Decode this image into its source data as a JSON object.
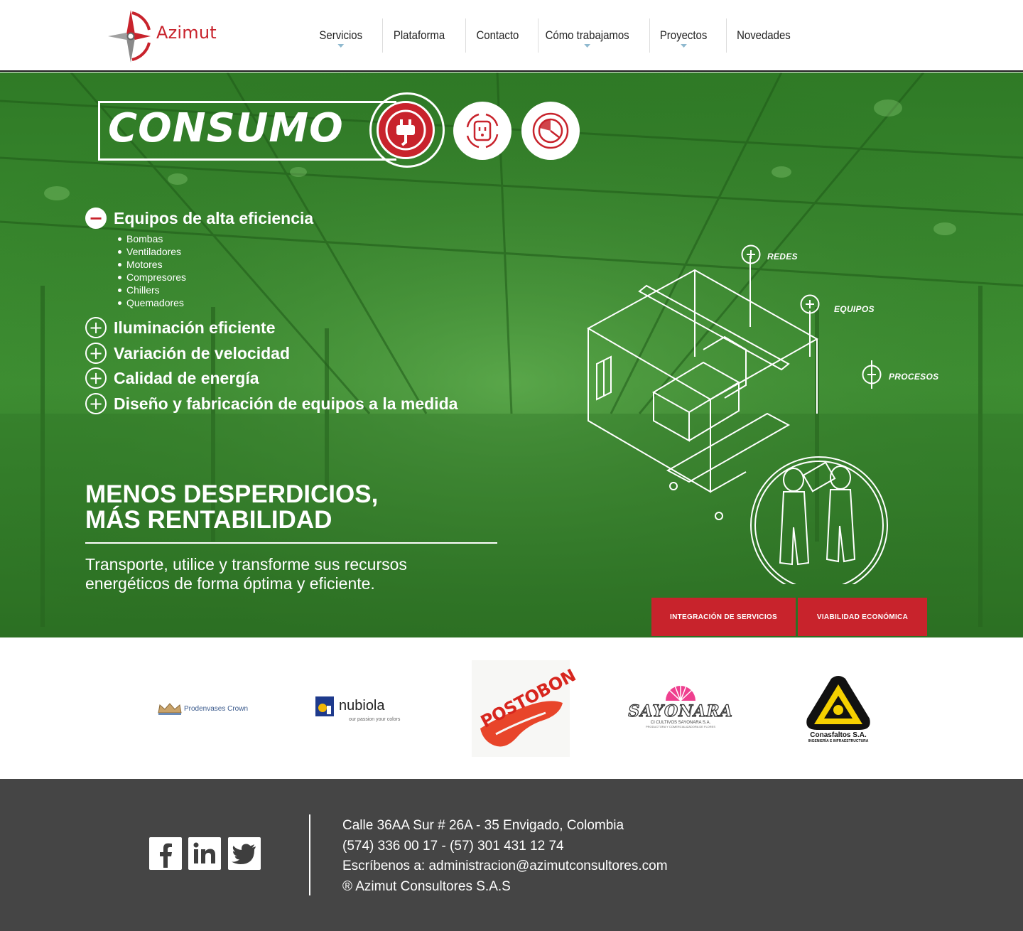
{
  "brand": {
    "name": "Azimut",
    "accent": "#c8232c"
  },
  "nav": {
    "items": [
      {
        "label": "Servicios",
        "has_dropdown": true
      },
      {
        "label": "Plataforma",
        "has_dropdown": false
      },
      {
        "label": "Contacto",
        "has_dropdown": false
      },
      {
        "label": "Cómo trabajamos",
        "has_dropdown": true
      },
      {
        "label": "Proyectos",
        "has_dropdown": true
      },
      {
        "label": "Novedades",
        "has_dropdown": false
      }
    ]
  },
  "hero": {
    "title": "CONSUMO",
    "category_icons": [
      "plug-icon",
      "outlet-cycle-icon",
      "pie-chart-icon"
    ],
    "accordion": [
      {
        "label": "Equipos de alta eficiencia",
        "expanded": true,
        "toggle": "−",
        "items": [
          "Bombas",
          "Ventiladores",
          "Motores",
          "Compresores",
          "Chillers",
          "Quemadores"
        ]
      },
      {
        "label": "Iluminación eficiente",
        "expanded": false,
        "toggle": "+"
      },
      {
        "label": "Variación de velocidad",
        "expanded": false,
        "toggle": "+"
      },
      {
        "label": "Calidad de energía",
        "expanded": false,
        "toggle": "+"
      },
      {
        "label": "Diseño y fabricación de equipos a la medida",
        "expanded": false,
        "toggle": "+"
      }
    ],
    "headline_line1": "MENOS DESPERDICIOS,",
    "headline_line2": "MÁS RENTABILIDAD",
    "description": "Transporte, utilice y transforme sus recursos energéticos de forma óptima y eficiente.",
    "diagram_labels": {
      "redes": "REDES",
      "equipos": "EQUIPOS",
      "procesos": "PROCESOS"
    },
    "cta_primary": "INTEGRACIÓN DE SERVICIOS",
    "cta_secondary": "VIABILIDAD ECONÓMICA",
    "overlay_color": "#3c8a2f"
  },
  "clients": {
    "prodenvases": "Prodenvases Crown",
    "nubiola": "nubiola",
    "nubiola_tagline": "our passion your colors",
    "postobon": "POSTOBON",
    "sayonara": "SAYONARA",
    "sayonara_sub": "CI CULTIVOS SAYONARA S.A.",
    "sayonara_sub2": "PRODUCTORA Y COMERCIALIZADORA DE FLORES",
    "conasfaltos": "Conasfaltos S.A.",
    "conasfaltos_sub": "INGENIERÍA E INFRAESTRUCTURA"
  },
  "footer": {
    "social": [
      "facebook-icon",
      "linkedin-icon",
      "twitter-icon"
    ],
    "address": "Calle 36AA Sur # 26A - 35 Envigado, Colombia",
    "phones": "(574) 336 00 17 - (57) 301 431 12 74",
    "email_prefix": "Escríbenos a: ",
    "email": "administracion@azimutconsultores.com",
    "copyright": "® Azimut Consultores S.A.S"
  }
}
